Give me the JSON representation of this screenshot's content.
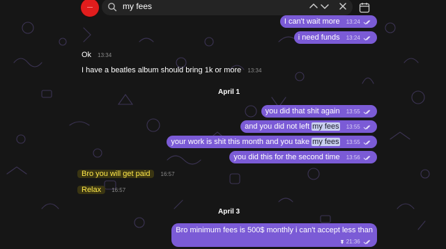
{
  "search": {
    "query": "my fees"
  },
  "messages_top_out": [
    {
      "text": "I can't wait more",
      "time": "13:24"
    },
    {
      "text": "i need funds",
      "time": "13:24"
    }
  ],
  "messages_in_1": [
    {
      "text": "Ok",
      "time": "13:34"
    },
    {
      "text": "I have a beatles album should bring 1k or more",
      "time": "13:34"
    }
  ],
  "date_1": "April 1",
  "messages_out_2": [
    {
      "text": "you did that shit again",
      "time": "13:55"
    },
    {
      "pre": "and you did not left ",
      "hl": "my fees",
      "time": "13:55"
    },
    {
      "pre": "your work is shit this month and you take ",
      "hl": "my fees",
      "time": "13:55"
    },
    {
      "text": "you did this for the second time",
      "time": "13:56"
    }
  ],
  "messages_in_2": [
    {
      "text": "Bro you will get paid",
      "time": "16:57"
    },
    {
      "text": "Relax",
      "time": "16:57"
    }
  ],
  "date_2": "April 3",
  "messages_out_3": [
    {
      "text": "Bro minimum fees is 500$ monthly i can't accept less than",
      "time": "21:36"
    }
  ],
  "colors": {
    "accent": "#7b5bd6",
    "background": "#161616",
    "highlight": "#c9cff0",
    "avatar": "#e11d1d"
  },
  "icons": [
    "search-icon",
    "chevron-up-icon",
    "chevron-down-icon",
    "close-icon",
    "calendar-icon",
    "double-check-icon",
    "pin-icon"
  ]
}
